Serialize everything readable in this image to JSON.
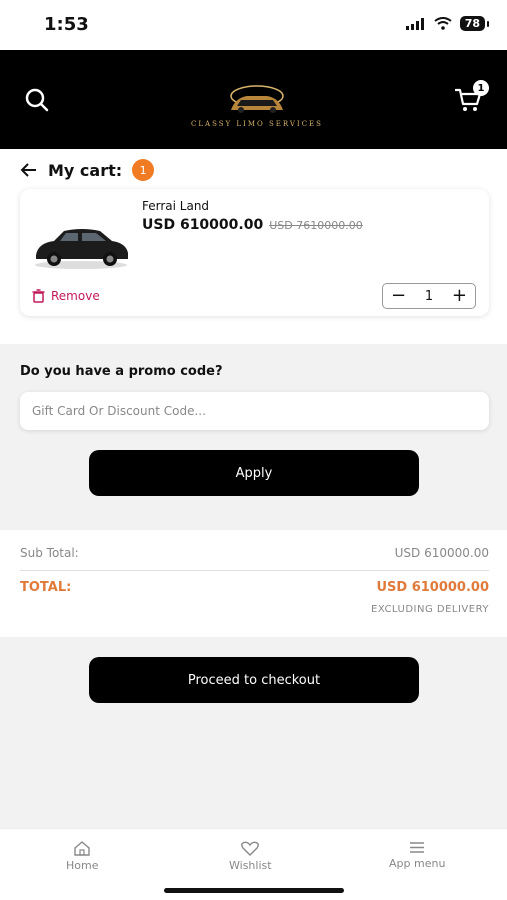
{
  "status_bar": {
    "time": "1:53",
    "battery": "78"
  },
  "header": {
    "logo_text": "CLASSY LIMO SERVICES",
    "cart_count": "1",
    "icons": [
      "search-icon",
      "cart-icon"
    ]
  },
  "cart": {
    "title": "My cart:",
    "count": "1",
    "items": [
      {
        "name": "Ferrai Land",
        "price": "USD 610000.00",
        "old_price": "USD 7610000.00",
        "remove_label": "Remove",
        "quantity": "1"
      }
    ]
  },
  "promo": {
    "label": "Do you have a promo code?",
    "placeholder": "Gift Card Or Discount Code...",
    "apply_label": "Apply"
  },
  "totals": {
    "sub_total_label": "Sub Total:",
    "sub_total_value": "USD 610000.00",
    "total_label": "TOTAL:",
    "total_value": "USD 610000.00",
    "note": "EXCLUDING DELIVERY"
  },
  "checkout": {
    "label": "Proceed to checkout"
  },
  "bottom_nav": {
    "items": [
      {
        "label": "Home",
        "icon": "home-icon"
      },
      {
        "label": "Wishlist",
        "icon": "heart-icon"
      },
      {
        "label": "App menu",
        "icon": "menu-icon"
      }
    ]
  },
  "colors": {
    "accent": "#f07b22",
    "total": "#e07a3a",
    "remove": "#c2185b",
    "primary": "#000000"
  }
}
